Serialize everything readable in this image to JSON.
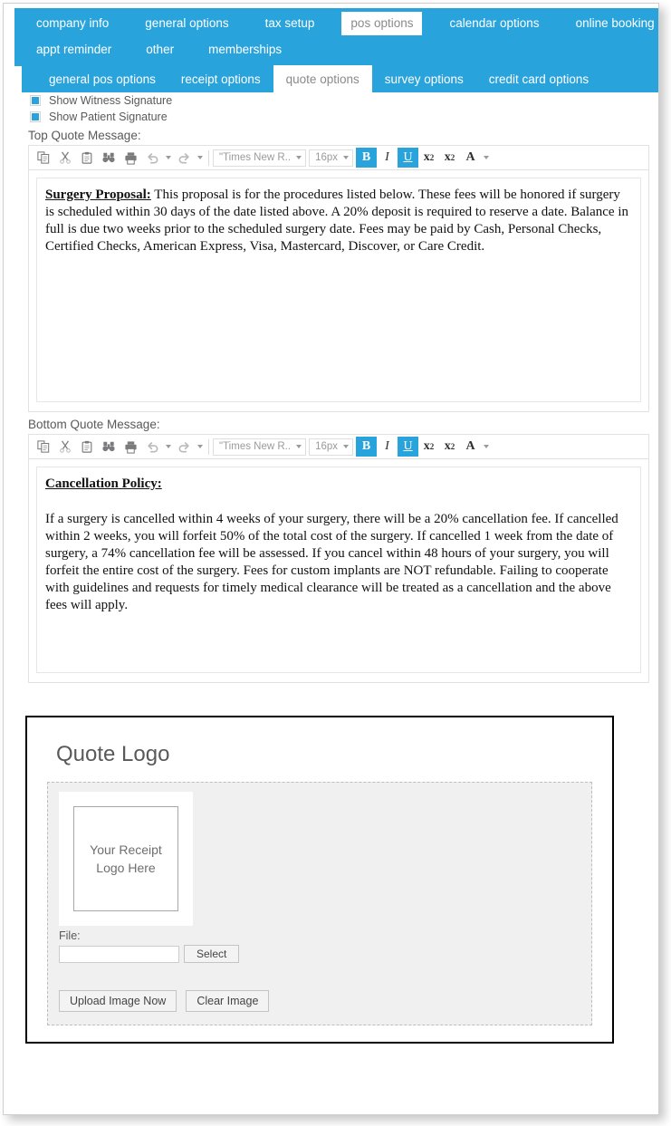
{
  "main_nav": {
    "row1": [
      {
        "label": "company info",
        "active": false
      },
      {
        "label": "general options",
        "active": false
      },
      {
        "label": "tax setup",
        "active": false
      },
      {
        "label": "pos options",
        "active": true
      },
      {
        "label": "calendar options",
        "active": false
      },
      {
        "label": "online booking",
        "active": false
      }
    ],
    "row2": [
      {
        "label": "appt reminder",
        "active": false
      },
      {
        "label": "other",
        "active": false
      },
      {
        "label": "memberships",
        "active": false
      }
    ]
  },
  "sub_nav": [
    {
      "label": "general pos options",
      "active": false
    },
    {
      "label": "receipt options",
      "active": false
    },
    {
      "label": "quote options",
      "active": true
    },
    {
      "label": "survey options",
      "active": false
    },
    {
      "label": "credit card options",
      "active": false
    }
  ],
  "options": {
    "witness_label": "Show Witness Signature",
    "witness_checked": true,
    "patient_label": "Show Patient Signature",
    "patient_checked": true
  },
  "top_editor": {
    "label": "Top Quote Message:",
    "toolbar": {
      "font_family": "\"Times New R..",
      "font_size": "16px",
      "bold": "B",
      "italic": "I",
      "underline": "U",
      "superscript_base": "x",
      "superscript_exp": "2",
      "subscript_base": "x",
      "subscript_exp": "2",
      "text_color": "A",
      "bold_active": true,
      "italic_active": false,
      "underline_active": true
    },
    "heading": "Surgery Proposal:",
    "body": " This proposal is for the procedures listed below. These fees will be honored if surgery is scheduled within 30 days of the date listed above. A 20% deposit is required to reserve a date. Balance in full is due two weeks prior to the scheduled surgery date. Fees may be paid by Cash, Personal Checks, Certified Checks, American Express, Visa, Mastercard, Discover, or Care Credit."
  },
  "bottom_editor": {
    "label": "Bottom Quote Message:",
    "toolbar": {
      "font_family": "\"Times New R..",
      "font_size": "16px",
      "bold": "B",
      "italic": "I",
      "underline": "U",
      "superscript_base": "x",
      "superscript_exp": "2",
      "subscript_base": "x",
      "subscript_exp": "2",
      "text_color": "A",
      "bold_active": true,
      "italic_active": false,
      "underline_active": true
    },
    "heading": "Cancellation Policy:",
    "body": "If a surgery is cancelled within 4 weeks of your surgery, there will be a 20% cancellation fee. If cancelled within 2 weeks, you will forfeit 50% of the total cost of the surgery. If cancelled 1 week from the date of surgery, a 74% cancellation fee will be assessed. If you cancel within 48 hours of your surgery, you will forfeit the entire cost of the surgery. Fees for custom implants are NOT refundable. Failing to cooperate with guidelines and requests for timely medical clearance will be treated as a cancellation and the above fees will apply."
  },
  "quote_logo": {
    "title": "Quote Logo",
    "placeholder_line1": "Your Receipt",
    "placeholder_line2": "Logo Here",
    "file_label": "File:",
    "file_value": "",
    "select_button": "Select",
    "upload_button": "Upload Image Now",
    "clear_button": "Clear Image"
  },
  "colors": {
    "brand_blue": "#29a3dc",
    "text_gray": "#58595b",
    "toolbar_icon": "#6f7072"
  },
  "icons": {
    "copy": "copy-icon",
    "cut": "cut-icon",
    "paste": "paste-icon",
    "find": "find-binoculars-icon",
    "print": "print-icon",
    "undo": "undo-icon",
    "redo": "redo-icon"
  }
}
